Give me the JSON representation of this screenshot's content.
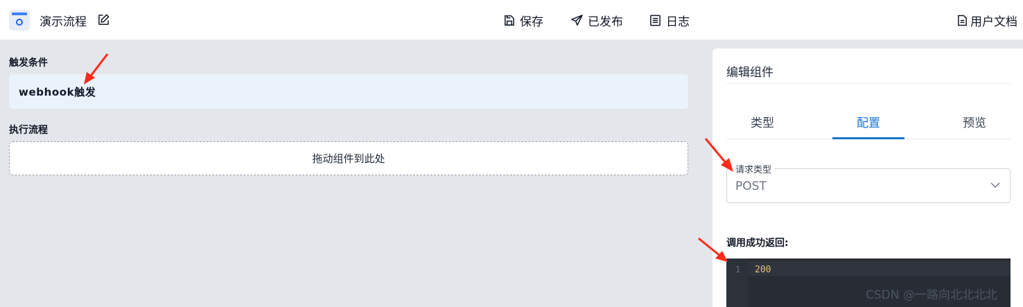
{
  "header": {
    "flow_title": "演示流程",
    "save_label": "保存",
    "publish_label": "已发布",
    "log_label": "日志",
    "docs_label": "用户文档"
  },
  "canvas": {
    "trigger_section_label": "触发条件",
    "trigger_name": "webhook触发",
    "flow_section_label": "执行流程",
    "drop_zone_text": "拖动组件到此处"
  },
  "panel": {
    "title": "编辑组件",
    "tabs": [
      {
        "label": "类型",
        "active": false
      },
      {
        "label": "配置",
        "active": true
      },
      {
        "label": "预览",
        "active": false
      }
    ],
    "request_type": {
      "label": "请求类型",
      "value": "POST"
    },
    "success_return": {
      "label": "调用成功返回:",
      "line_number": "1",
      "code": "200"
    }
  },
  "watermark": "CSDN @一路向北北北北",
  "colors": {
    "accent": "#1976d2",
    "canvas_bg": "#e3e6ea",
    "trigger_bg": "#eaf3fc",
    "editor_bg": "#282c34",
    "annotation_arrow": "#ff2a1a"
  }
}
